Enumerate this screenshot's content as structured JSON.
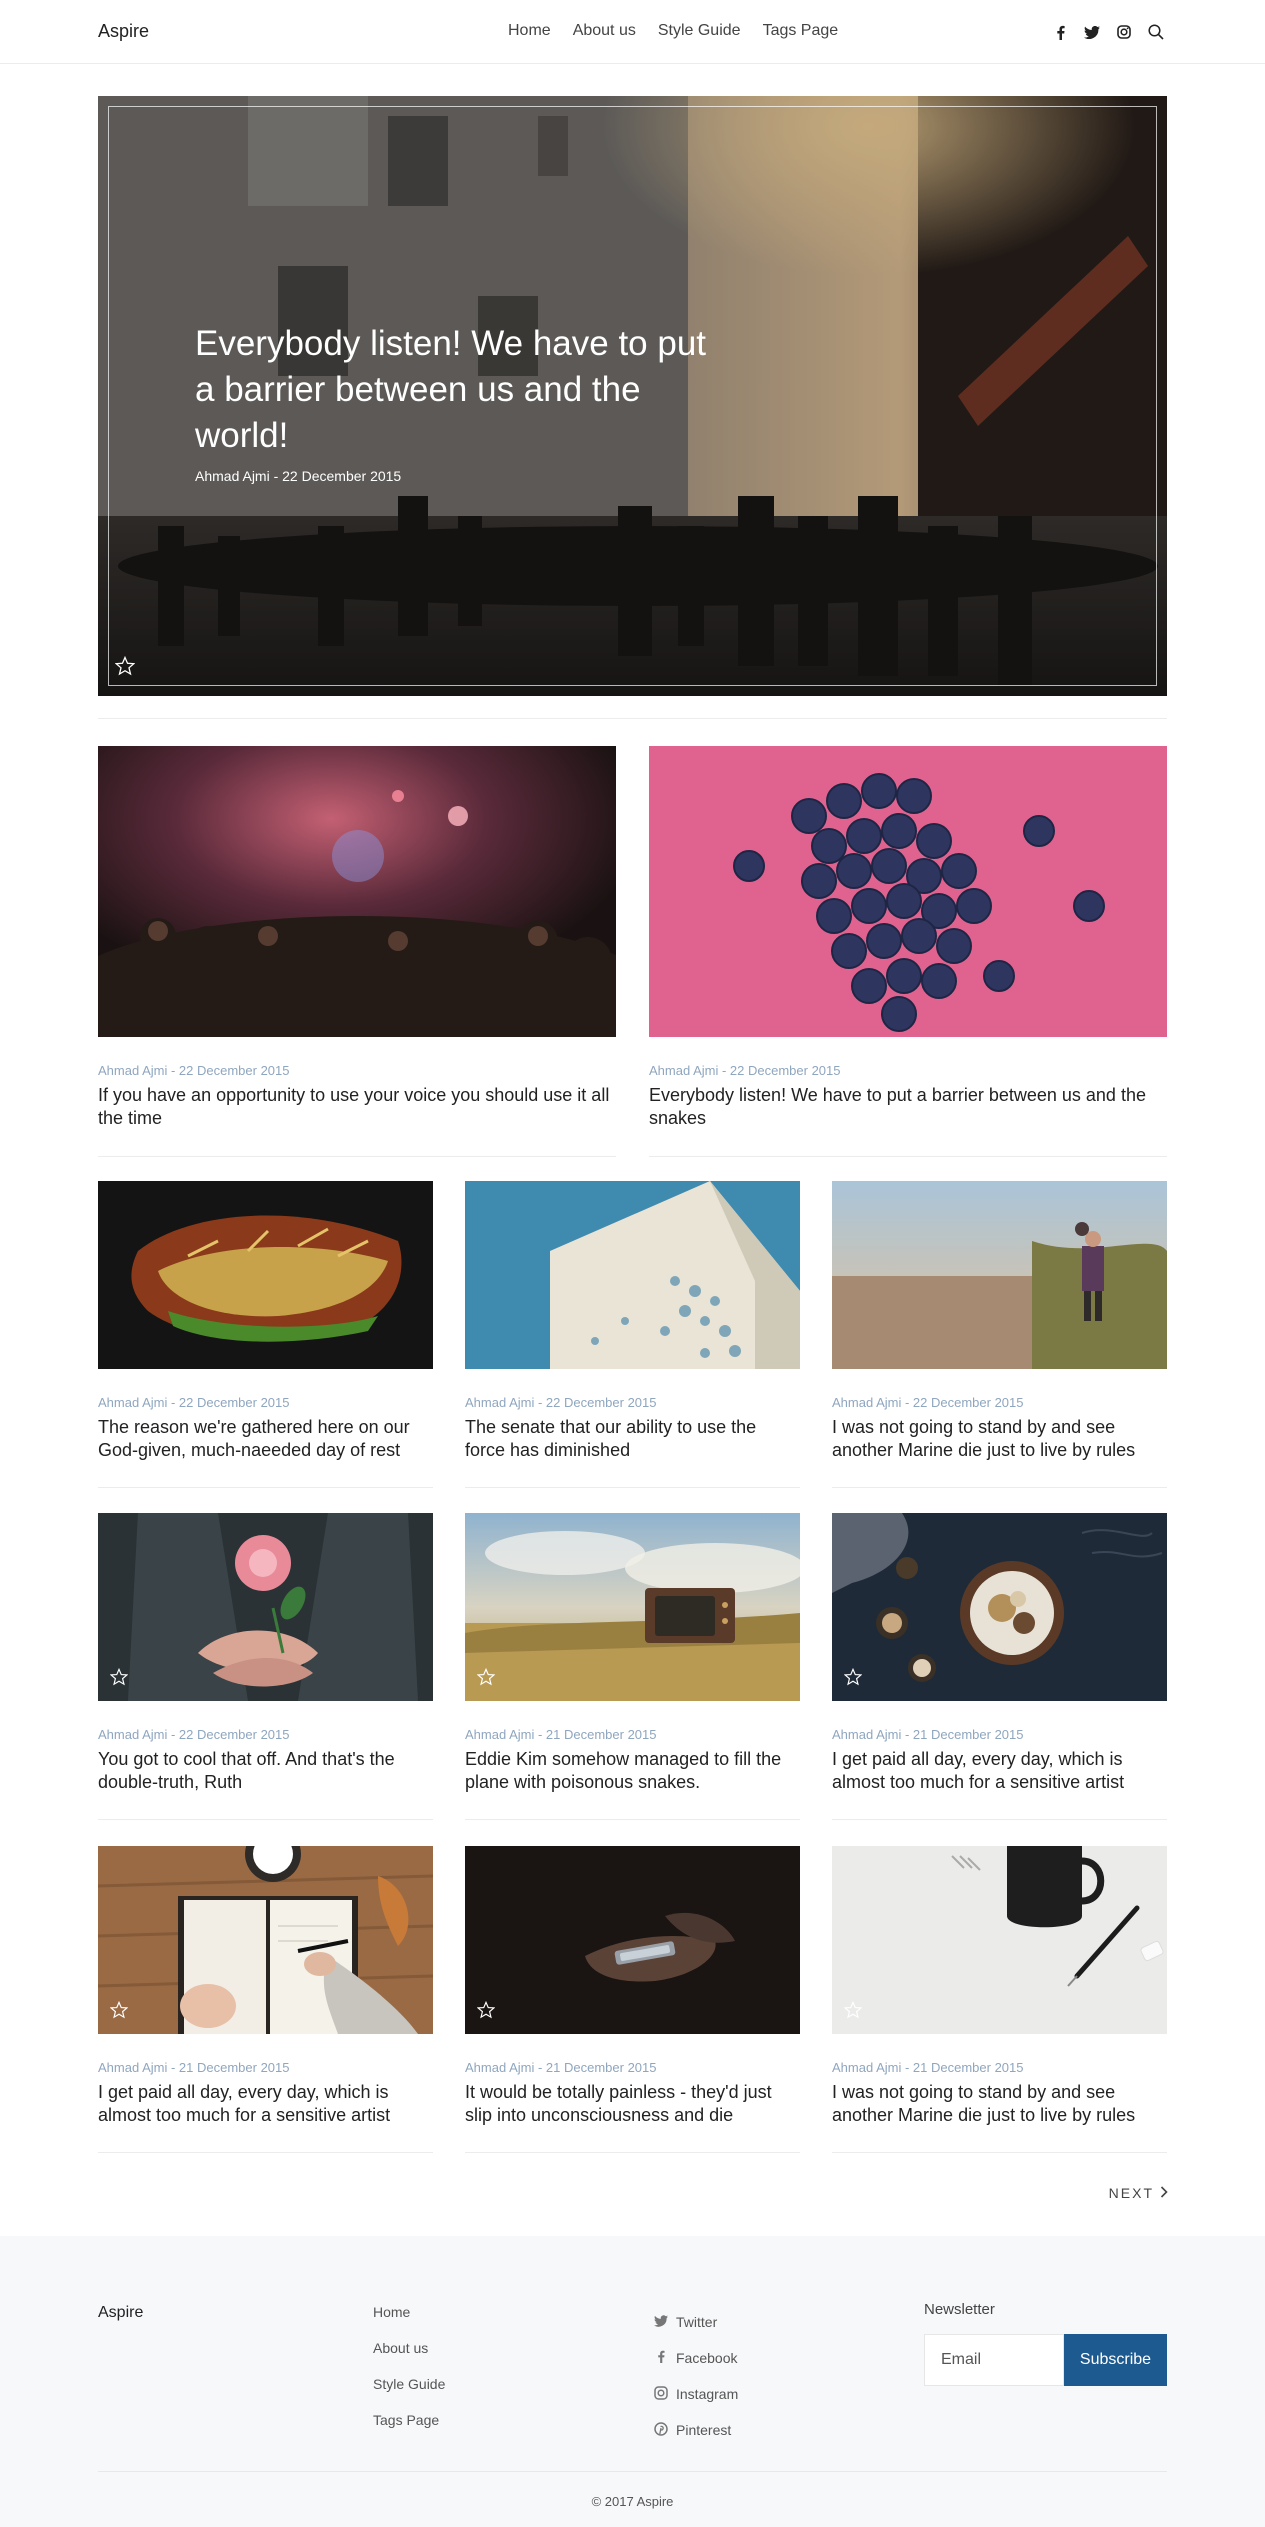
{
  "header": {
    "brand": "Aspire",
    "nav": [
      "Home",
      "About us",
      "Style Guide",
      "Tags Page"
    ],
    "icons": [
      "facebook-icon",
      "twitter-icon",
      "instagram-icon",
      "search-icon"
    ]
  },
  "hero": {
    "title": "Everybody listen! We have to put a barrier between us and the world!",
    "meta": "Ahmad Ajmi - 22 December 2015"
  },
  "posts": [
    {
      "meta": "Ahmad Ajmi - 22 December 2015",
      "title": "If you have an opportunity to use your voice you should use it all the time"
    },
    {
      "meta": "Ahmad Ajmi - 22 December 2015",
      "title": "Everybody listen! We have to put a barrier between us and the snakes"
    },
    {
      "meta": "Ahmad Ajmi - 22 December 2015",
      "title": "The reason we're gathered here on our God-given, much-naeeded day of rest"
    },
    {
      "meta": "Ahmad Ajmi - 22 December 2015",
      "title": "The senate that our ability to use the force has diminished"
    },
    {
      "meta": "Ahmad Ajmi - 22 December 2015",
      "title": "I was not going to stand by and see another Marine die just to live by rules"
    },
    {
      "meta": "Ahmad Ajmi - 22 December 2015",
      "title": "You got to cool that off. And that's the double-truth, Ruth"
    },
    {
      "meta": "Ahmad Ajmi - 21 December 2015",
      "title": "Eddie Kim somehow managed to fill the plane with poisonous snakes."
    },
    {
      "meta": "Ahmad Ajmi - 21 December 2015",
      "title": "I get paid all day, every day, which is almost too much for a sensitive artist"
    },
    {
      "meta": "Ahmad Ajmi - 21 December 2015",
      "title": "I get paid all day, every day, which is almost too much for a sensitive artist"
    },
    {
      "meta": "Ahmad Ajmi - 21 December 2015",
      "title": "It would be totally painless - they'd just slip into unconsciousness and die"
    },
    {
      "meta": "Ahmad Ajmi - 21 December 2015",
      "title": "I was not going to stand by and see another Marine die just to live by rules"
    }
  ],
  "pagination": {
    "next": "NEXT"
  },
  "footer": {
    "brand": "Aspire",
    "links": [
      "Home",
      "About us",
      "Style Guide",
      "Tags Page"
    ],
    "social": [
      "Twitter",
      "Facebook",
      "Instagram",
      "Pinterest"
    ],
    "newsletter": {
      "label": "Newsletter",
      "placeholder": "Email",
      "button": "Subscribe"
    },
    "copyright": "© 2017 Aspire"
  },
  "colors": {
    "accent": "#1d5a8f",
    "meta": "#8fa6bf"
  }
}
